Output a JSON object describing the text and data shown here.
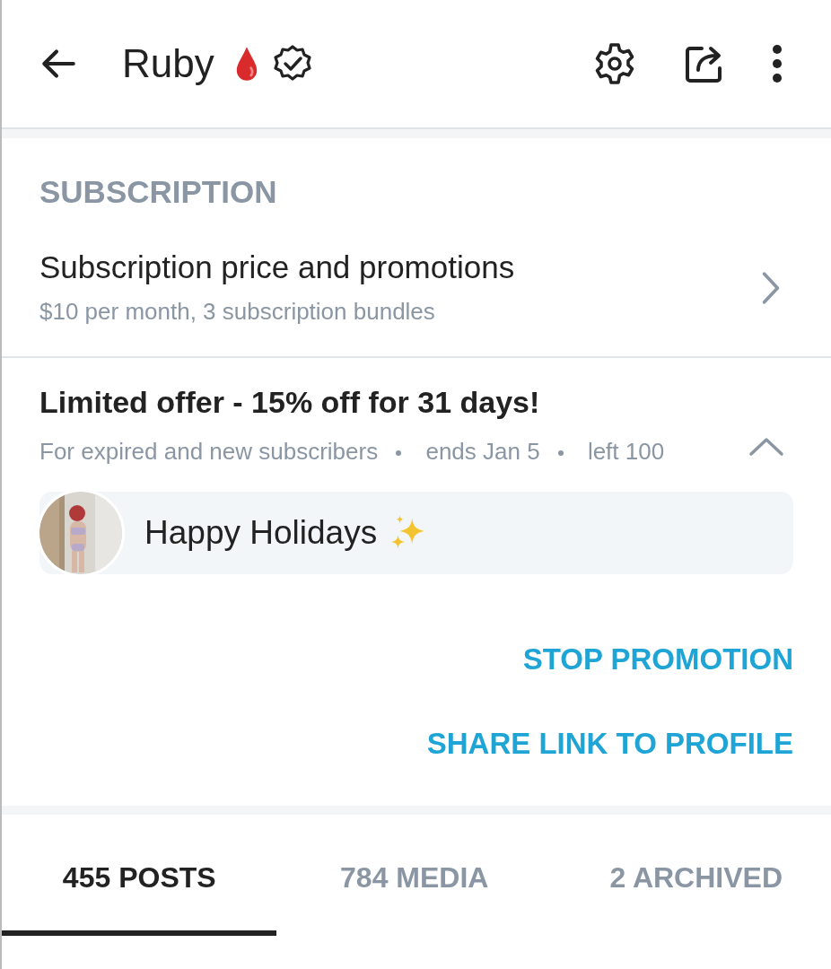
{
  "header": {
    "title": "Ruby"
  },
  "subscription": {
    "heading": "SUBSCRIPTION",
    "title": "Subscription price and promotions",
    "subtitle": "$10 per month, 3 subscription bundles"
  },
  "offer": {
    "title": "Limited offer - 15% off for 31 days!",
    "meta": [
      "For expired and new subscribers",
      "ends Jan 5",
      "left 100"
    ],
    "expanded": true,
    "message": "Happy Holidays"
  },
  "actions": [
    "STOP PROMOTION",
    "SHARE LINK TO PROFILE"
  ],
  "tabs": [
    {
      "label": "455 POSTS",
      "selected": true
    },
    {
      "label": "784 MEDIA",
      "selected": false
    },
    {
      "label": "2 ARCHIVED",
      "selected": false
    }
  ]
}
